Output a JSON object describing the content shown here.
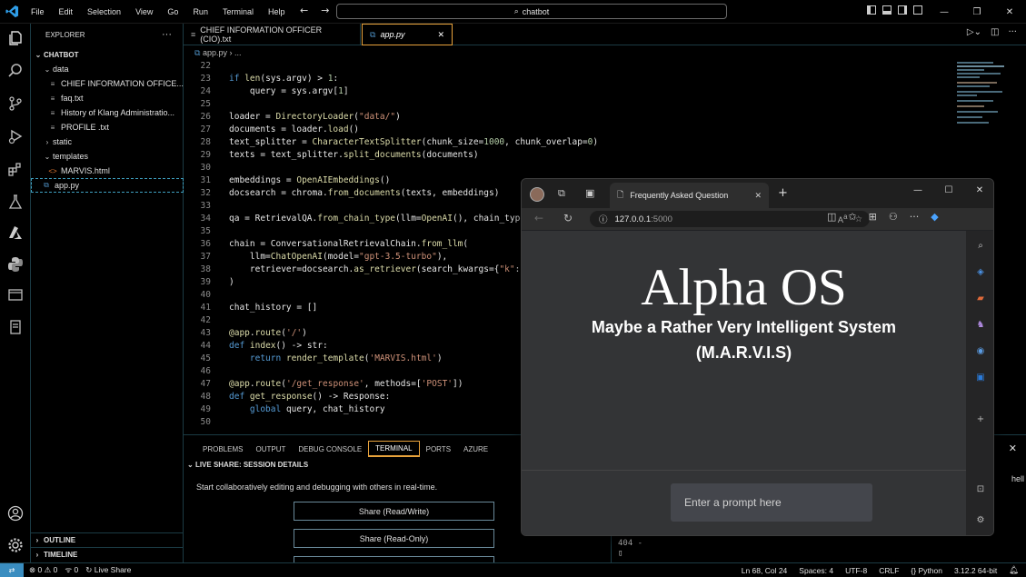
{
  "menu": [
    "File",
    "Edit",
    "Selection",
    "View",
    "Go",
    "Run",
    "Terminal",
    "Help"
  ],
  "search": {
    "text": "chatbot"
  },
  "explorer": {
    "title": "EXPLORER",
    "root": "CHATBOT",
    "items": [
      {
        "label": "data",
        "kind": "folder-open"
      },
      {
        "label": "CHIEF INFORMATION OFFICE...",
        "kind": "file"
      },
      {
        "label": "faq.txt",
        "kind": "file"
      },
      {
        "label": "History of Klang Administratio...",
        "kind": "file"
      },
      {
        "label": "PROFILE .txt",
        "kind": "file"
      },
      {
        "label": "static",
        "kind": "folder-closed"
      },
      {
        "label": "templates",
        "kind": "folder-open"
      },
      {
        "label": "MARVIS.html",
        "kind": "html"
      },
      {
        "label": "app.py",
        "kind": "py"
      }
    ],
    "outline": "OUTLINE",
    "timeline": "TIMELINE"
  },
  "tabs": [
    {
      "label": "CHIEF INFORMATION OFFICER (CIO).txt",
      "active": false
    },
    {
      "label": "app.py",
      "active": true
    }
  ],
  "breadcrumb": [
    "app.py",
    "..."
  ],
  "code": [
    {
      "n": "22",
      "t": ""
    },
    {
      "n": "23",
      "t": "if len(sys.argv) > 1:"
    },
    {
      "n": "24",
      "t": "    query = sys.argv[1]"
    },
    {
      "n": "25",
      "t": ""
    },
    {
      "n": "26",
      "t": "loader = DirectoryLoader(\"data/\")"
    },
    {
      "n": "27",
      "t": "documents = loader.load()"
    },
    {
      "n": "28",
      "t": "text_splitter = CharacterTextSplitter(chunk_size=1000, chunk_overlap=0)"
    },
    {
      "n": "29",
      "t": "texts = text_splitter.split_documents(documents)"
    },
    {
      "n": "30",
      "t": ""
    },
    {
      "n": "31",
      "t": "embeddings = OpenAIEmbeddings()"
    },
    {
      "n": "32",
      "t": "docsearch = chroma.from_documents(texts, embeddings)"
    },
    {
      "n": "33",
      "t": ""
    },
    {
      "n": "34",
      "t": "qa = RetrievalQA.from_chain_type(llm=OpenAI(), chain_type"
    },
    {
      "n": "35",
      "t": ""
    },
    {
      "n": "36",
      "t": "chain = ConversationalRetrievalChain.from_llm("
    },
    {
      "n": "37",
      "t": "    llm=ChatOpenAI(model=\"gpt-3.5-turbo\"),"
    },
    {
      "n": "38",
      "t": "    retriever=docsearch.as_retriever(search_kwargs={\"k\":"
    },
    {
      "n": "39",
      "t": ")"
    },
    {
      "n": "40",
      "t": ""
    },
    {
      "n": "41",
      "t": "chat_history = []"
    },
    {
      "n": "42",
      "t": ""
    },
    {
      "n": "43",
      "t": "@app.route('/')"
    },
    {
      "n": "44",
      "t": "def index() -> str:"
    },
    {
      "n": "45",
      "t": "    return render_template('MARVIS.html')"
    },
    {
      "n": "46",
      "t": ""
    },
    {
      "n": "47",
      "t": "@app.route('/get_response', methods=['POST'])"
    },
    {
      "n": "48",
      "t": "def get_response() -> Response:"
    },
    {
      "n": "49",
      "t": "    global query, chat_history"
    },
    {
      "n": "50",
      "t": ""
    }
  ],
  "panel": {
    "tabs": [
      "PROBLEMS",
      "OUTPUT",
      "DEBUG CONSOLE",
      "TERMINAL",
      "PORTS",
      "AZURE"
    ],
    "active_tab": "TERMINAL",
    "live_share_title": "LIVE SHARE: SESSION DETAILS",
    "live_share_desc": "Start collaboratively editing and debugging with others in real-time.",
    "buttons": [
      "Share (Read/Write)",
      "Share (Read-Only)"
    ],
    "terminal_lines": [
      "404 -",
      "▯"
    ],
    "right_fragment": "hell"
  },
  "status": {
    "errors": "0",
    "warnings": "0",
    "ports": "0",
    "live_share": "Live Share",
    "position": "Ln 68, Col 24",
    "spaces": "Spaces: 4",
    "encoding": "UTF-8",
    "eol": "CRLF",
    "language": "Python",
    "interpreter": "3.12.2 64-bit"
  },
  "browser": {
    "tab_title": "Frequently Asked Question",
    "url_host": "127.0.0.1",
    "url_port": ":5000",
    "page": {
      "title": "Alpha OS",
      "subtitle": "Maybe a Rather Very Intelligent System",
      "acronym": "(M.A.R.V.I.S)",
      "prompt_placeholder": "Enter a prompt here"
    }
  },
  "colors": {
    "accent_border": "#1b3b44",
    "active_tab_border": "#e8a33c",
    "keyword": "#569cd6",
    "function": "#dcdcaa",
    "string": "#ce9178",
    "variable": "#9cdcfe",
    "class": "#4ec9b0"
  }
}
